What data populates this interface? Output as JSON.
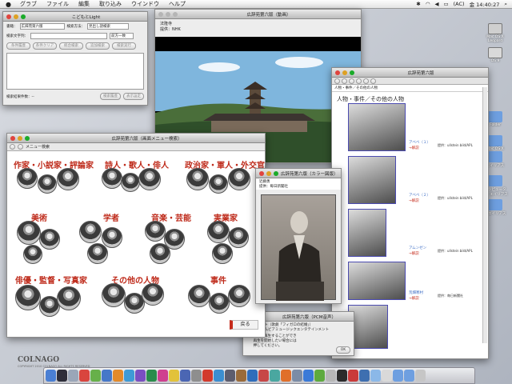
{
  "menubar": {
    "items": [
      "グラブ",
      "ファイル",
      "編集",
      "取り込み",
      "ウインドウ",
      "ヘルプ"
    ],
    "battery": "(AC)",
    "clock": "金 14:40:27"
  },
  "desktop": {
    "icons": [
      "Mac OS X Leopard",
      "OS 9",
      "Folder",
      "Mac OS X",
      "エイリアス",
      "コンピューター・エイリアス",
      "のエイリアス"
    ],
    "brand": "COLNAGO",
    "brand_sub": "COPYRIGHT 2010 COLNAGO ALL RIGHTS RESERVED"
  },
  "light": {
    "title": "こどもとLight",
    "book_label": "書籍：",
    "book_value": "広辞苑第六版",
    "method_label": "検索方法：",
    "method_value": "見出し語検索",
    "search_label": "検索文字列：",
    "match_label": "前方一致",
    "buttons": [
      "条件履歴",
      "条件クリア",
      "統合検索",
      "追加検索",
      "検索実行"
    ],
    "count_label": "検索結果件数：--",
    "bottom_buttons": [
      "検索履歴",
      "表示設定"
    ]
  },
  "video": {
    "title": "広辞苑第六版（動画）",
    "line1": "法隆寺",
    "line2": "提供：NHK"
  },
  "menu": {
    "title": "広辞苑第六版（画面メニュー検索）",
    "toolbar_label": "メニュー検索",
    "back": "戻る",
    "categories": [
      "作家・小説家・評論家",
      "詩人・歌人・俳人",
      "政治家・軍人・外交官",
      "美術",
      "学者",
      "音楽・芸能",
      "実業家",
      "俳優・監督・写真家",
      "その他の人物",
      "事件"
    ]
  },
  "color": {
    "title": "広辞苑第六版（カラー図版）",
    "line1": "近藤勇",
    "line2": "提供：毎日新聞社"
  },
  "pcm": {
    "title": "広辞苑第六版（PCM音声）",
    "line1": "モーツァルト（歌劇「フィガロの結婚」）",
    "line2": "提供：コロムビアミュージックエンタテインメント",
    "msg1": "音声を再生することができ",
    "msg2": "再生を開始したい場合には",
    "msg3": "押してください。",
    "ok": "OK"
  },
  "people": {
    "title": "広辞苑第六版",
    "breadcrumb": "人物・事件／その他の人物",
    "heading": "人物・事件／その他の人物",
    "more": "→解説",
    "entries": [
      {
        "name": "アベベ（１）",
        "credit": "提供：ullstein bild/APL"
      },
      {
        "name": "アベベ（２）",
        "credit": "提供：ullstein bild/APL"
      },
      {
        "name": "アムンゼン",
        "credit": "提供：ullstein bild/APL"
      },
      {
        "name": "荒畑寒村",
        "credit": "提供：毎日新聞社"
      }
    ]
  }
}
